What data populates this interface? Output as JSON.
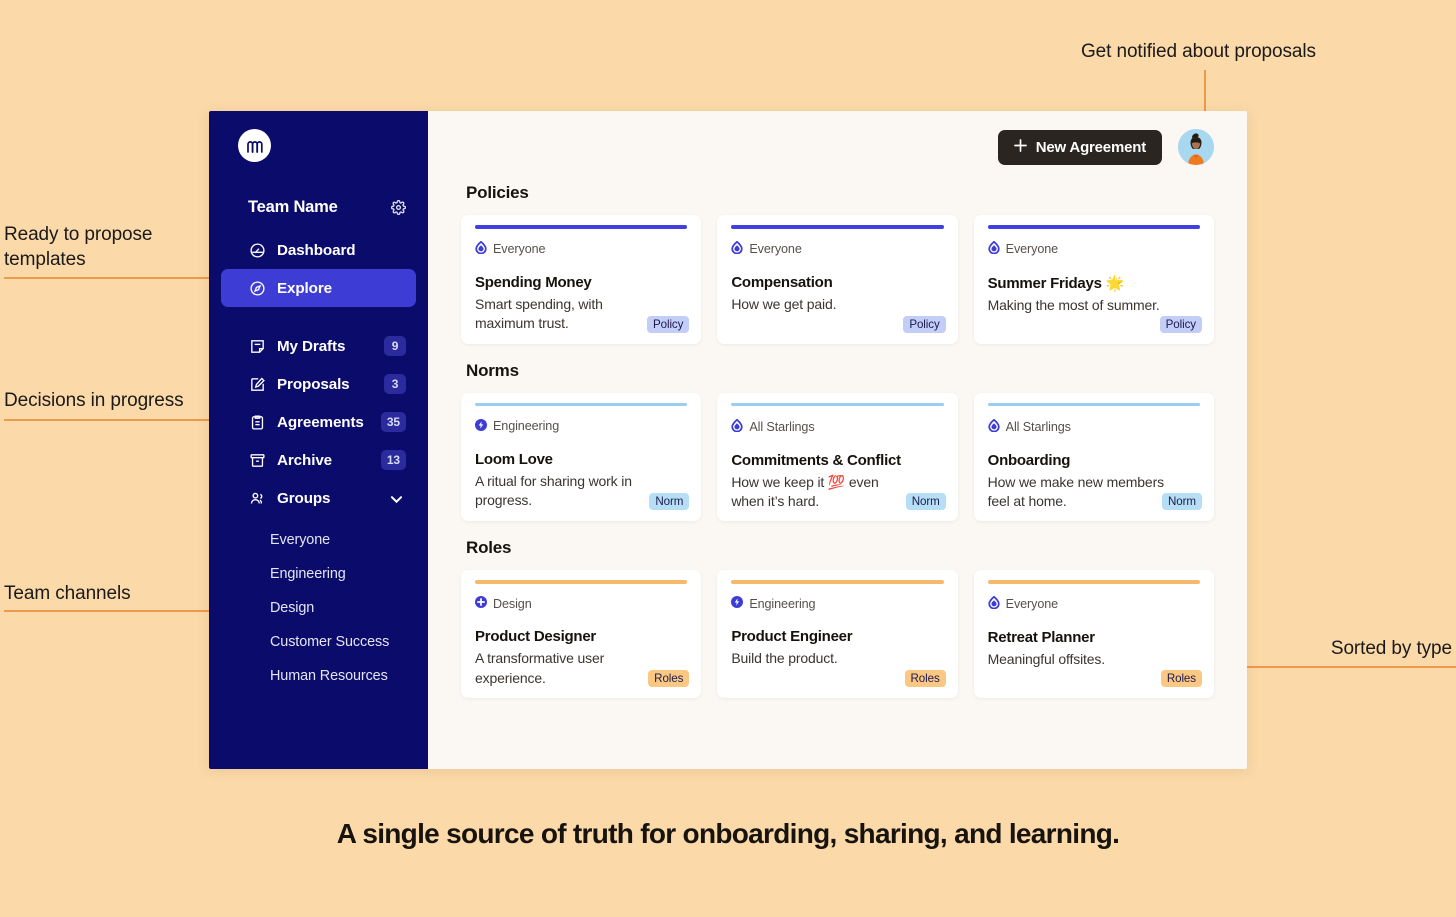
{
  "annotations": {
    "top_right": "Get notified about proposals",
    "left_1": "Ready to propose\ntemplates",
    "left_2": "Decisions in progress",
    "left_3": "Team channels",
    "right_1": "Sorted by type"
  },
  "caption": "A single source of truth for onboarding, sharing, and learning.",
  "sidebar": {
    "logo_icon": "brand-logo-icon",
    "team_name": "Team Name",
    "settings_icon": "gear-icon",
    "nav": [
      {
        "label": "Dashboard",
        "icon": "dashboard-icon",
        "count": "",
        "active": false
      },
      {
        "label": "Explore",
        "icon": "compass-icon",
        "count": "",
        "active": true
      },
      {
        "label": "My Drafts",
        "icon": "draft-note-icon",
        "count": "9",
        "active": false
      },
      {
        "label": "Proposals",
        "icon": "edit-square-icon",
        "count": "3",
        "active": false
      },
      {
        "label": "Agreements",
        "icon": "clipboard-icon",
        "count": "35",
        "active": false
      },
      {
        "label": "Archive",
        "icon": "archive-box-icon",
        "count": "13",
        "active": false
      },
      {
        "label": "Groups",
        "icon": "people-icon",
        "count": "",
        "active": false
      }
    ],
    "groups": [
      "Everyone",
      "Engineering",
      "Design",
      "Customer Success",
      "Human Resources"
    ]
  },
  "topbar": {
    "new_agreement_label": "New Agreement",
    "plus_icon": "plus-icon",
    "avatar_icon": "user-avatar"
  },
  "colors": {
    "page_bg": "#FBD9A8",
    "sidebar_bg": "#0B0B6B",
    "active_nav": "#3D3DD6",
    "main_bg": "#FBF8F3",
    "accent_line": "#EE9A4D",
    "policy_bar": "#4040E0",
    "norm_bar": "#9CCEF0",
    "roles_bar": "#F6B96A",
    "policy_tag_bg": "#C3CEF8",
    "norm_tag_bg": "#B6DFF6",
    "roles_tag_bg": "#FAC883"
  },
  "sections": [
    {
      "title": "Policies",
      "bar_color": "#4040E0",
      "tag_bg": "#C3CEF8",
      "cards": [
        {
          "group": "Everyone",
          "group_icon": "everyone-drop-icon",
          "title": "Spending Money",
          "desc": "Smart spending, with maximum trust.",
          "tag": "Policy"
        },
        {
          "group": "Everyone",
          "group_icon": "everyone-drop-icon",
          "title": "Compensation",
          "desc": "How we get paid.",
          "tag": "Policy"
        },
        {
          "group": "Everyone",
          "group_icon": "everyone-drop-icon",
          "title": "Summer Fridays 🌟",
          "desc": "Making the most of summer.",
          "tag": "Policy"
        }
      ]
    },
    {
      "title": "Norms",
      "bar_color": "#9CCEF0",
      "tag_bg": "#B6DFF6",
      "cards": [
        {
          "group": "Engineering",
          "group_icon": "engineering-bolt-icon",
          "title": "Loom Love",
          "desc": "A ritual for sharing work in progress.",
          "tag": "Norm"
        },
        {
          "group": "All Starlings",
          "group_icon": "everyone-drop-icon",
          "title": "Commitments  & Conflict",
          "desc": "How we keep it 💯 even when it’s hard.",
          "tag": "Norm"
        },
        {
          "group": "All Starlings",
          "group_icon": "everyone-drop-icon",
          "title": "Onboarding",
          "desc": "How we make new members feel at home.",
          "tag": "Norm"
        }
      ]
    },
    {
      "title": "Roles",
      "bar_color": "#F6B96A",
      "tag_bg": "#FAC883",
      "cards": [
        {
          "group": "Design",
          "group_icon": "design-plus-icon",
          "title": "Product Designer",
          "desc": "A transformative user experience.",
          "tag": "Roles"
        },
        {
          "group": "Engineering",
          "group_icon": "engineering-bolt-icon",
          "title": "Product Engineer",
          "desc": "Build the product.",
          "tag": "Roles"
        },
        {
          "group": "Everyone",
          "group_icon": "everyone-drop-icon",
          "title": "Retreat Planner",
          "desc": "Meaningful offsites.",
          "tag": "Roles"
        }
      ]
    }
  ]
}
